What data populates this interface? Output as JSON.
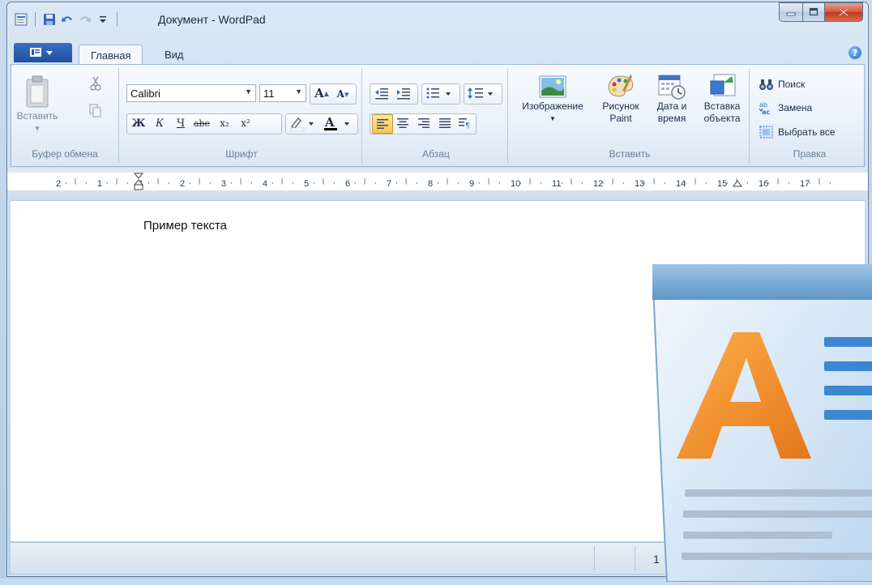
{
  "window": {
    "title": "Документ - WordPad"
  },
  "ribbon": {
    "app_menu_icon": "app-menu-icon",
    "tabs": [
      {
        "label": "Главная",
        "active": true
      },
      {
        "label": "Вид",
        "active": false
      }
    ],
    "clipboard": {
      "paste_label": "Вставить",
      "group_label": "Буфер обмена"
    },
    "font": {
      "family": "Calibri",
      "size": "11",
      "group_label": "Шрифт",
      "bold": "Ж",
      "italic": "К",
      "underline": "Ч",
      "strike": "abe",
      "subscript": "x₂",
      "superscript": "x²",
      "color_letter": "A"
    },
    "paragraph": {
      "group_label": "Абзац"
    },
    "insert": {
      "image_label": "Изображение",
      "paint_label": "Рисунок Paint",
      "datetime_label": "Дата и время",
      "object_label": "Вставка объекта",
      "group_label": "Вставить"
    },
    "editing": {
      "find_label": "Поиск",
      "replace_label": "Замена",
      "select_all_label": "Выбрать все",
      "group_label": "Правка"
    }
  },
  "ruler": {
    "marks": [
      "2",
      "1",
      "1",
      "2",
      "3",
      "4",
      "5",
      "6",
      "7",
      "8",
      "9",
      "10",
      "11",
      "12",
      "13",
      "14",
      "15",
      "16",
      "17"
    ]
  },
  "document": {
    "text": "Пример текста"
  },
  "status": {
    "page": "1"
  },
  "colors": {
    "accent": "#1f4f9f",
    "close": "#c4361a",
    "logo_orange": "#f08a24"
  }
}
